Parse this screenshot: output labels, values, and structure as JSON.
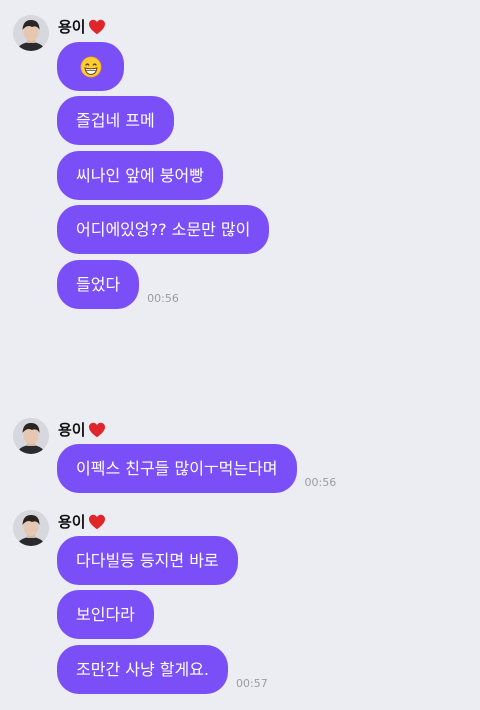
{
  "groups": [
    {
      "sender": "용이",
      "messages": [
        {
          "text": "",
          "emoji": "grinning-face-icon"
        },
        {
          "text": "즐겁네 프메"
        },
        {
          "text": "씨나인 앞에 붕어빵"
        },
        {
          "text": "어디에있엉?? 소문만 많이"
        },
        {
          "text": "들었다",
          "time": "00:56"
        }
      ]
    },
    {
      "sender": "용이",
      "messages": [
        {
          "text": "이펙스 친구들 많이ㅜ먹는다며",
          "time": "00:56"
        }
      ]
    },
    {
      "sender": "용이",
      "messages": [
        {
          "text": "다다빌등 등지면 바로"
        },
        {
          "text": "보인다라"
        },
        {
          "text": "조만간 사냥 할게요.",
          "time": "00:57"
        }
      ]
    }
  ],
  "icons": {
    "avatar": "profile-photo",
    "heart": "red-heart-icon",
    "emoji": "grinning-face-icon"
  },
  "colors": {
    "background": "#ecedf2",
    "bubble": "#7b4ff8",
    "bubble_text": "#ffffff",
    "time_text": "#9b9ca3",
    "heart": "#e0262a"
  }
}
